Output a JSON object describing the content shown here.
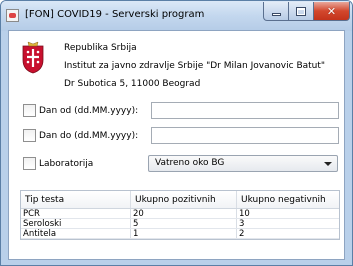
{
  "window": {
    "title": "[FON] COVID19 - Serverski program"
  },
  "header": {
    "line1": "Republika Srbija",
    "line2": "Institut za javno zdravlje Srbije \"Dr Milan Jovanovic Batut\"",
    "line3": "Dr Subotica 5, 11000 Beograd"
  },
  "filters": {
    "date_from_label": "Dan od (dd.MM.yyyy):",
    "date_from_value": "",
    "date_to_label": "Dan do (dd.MM.yyyy):",
    "date_to_value": "",
    "lab_label": "Laboratorija",
    "lab_selected": "Vatreno oko BG"
  },
  "table": {
    "columns": [
      "Tip testa",
      "Ukupno pozitivnih",
      "Ukupno negativnih"
    ],
    "rows": [
      [
        "PCR",
        "20",
        "10"
      ],
      [
        "Seroloski",
        "5",
        "3"
      ],
      [
        "Antitela",
        "1",
        "2"
      ]
    ]
  }
}
